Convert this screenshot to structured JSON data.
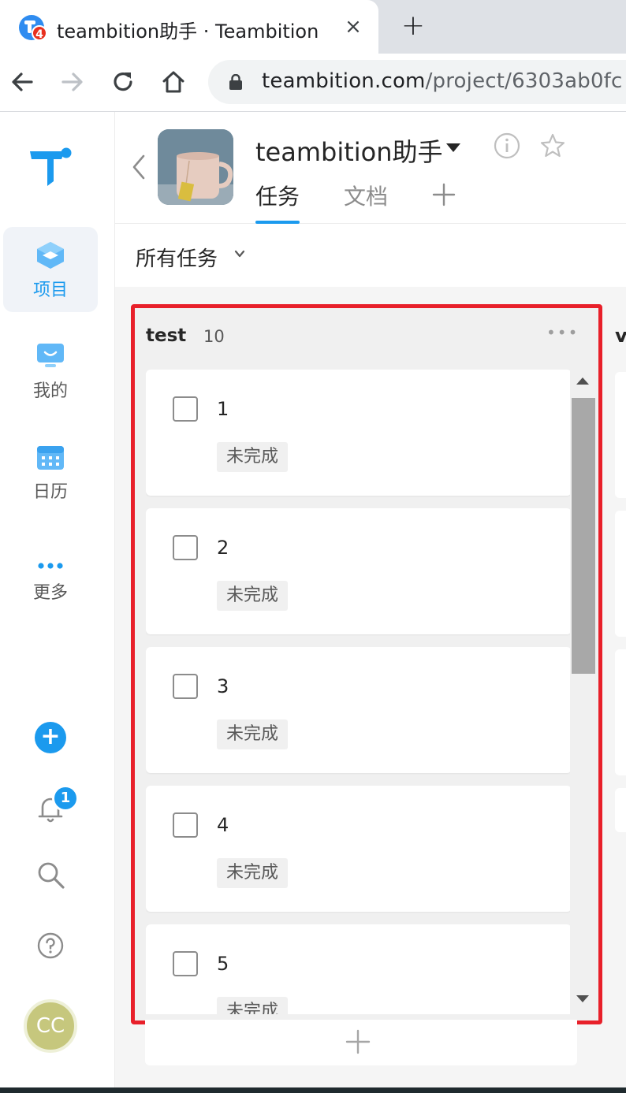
{
  "browser": {
    "tab_title": "teambition助手 · Teambition",
    "tab_badge": "4",
    "close_glyph": "×",
    "new_tab_glyph": "+",
    "url_host": "teambition.com",
    "url_path": "/project/6303ab0fc"
  },
  "rail": {
    "items": [
      {
        "label": "项目",
        "icon": "project-cube-icon"
      },
      {
        "label": "我的",
        "icon": "monitor-icon"
      },
      {
        "label": "日历",
        "icon": "calendar-icon"
      },
      {
        "label": "更多",
        "icon": "more-dots-icon"
      }
    ],
    "plus_glyph": "+",
    "notification_count": "1",
    "avatar_initials": "CC"
  },
  "project": {
    "title": "teambition助手",
    "tabs": [
      {
        "label": "任务",
        "active": true
      },
      {
        "label": "文档",
        "active": false
      }
    ],
    "filter_label": "所有任务"
  },
  "board": {
    "column": {
      "name": "test",
      "count": "10",
      "more_glyph": "•••"
    },
    "tasks": [
      {
        "title": "1",
        "status": "未完成"
      },
      {
        "title": "2",
        "status": "未完成"
      },
      {
        "title": "3",
        "status": "未完成"
      },
      {
        "title": "4",
        "status": "未完成"
      },
      {
        "title": "5",
        "status": "未完成"
      }
    ],
    "next_column_initial": "v"
  },
  "colors": {
    "accent": "#1b9aee",
    "highlight_border": "#e8202a"
  }
}
